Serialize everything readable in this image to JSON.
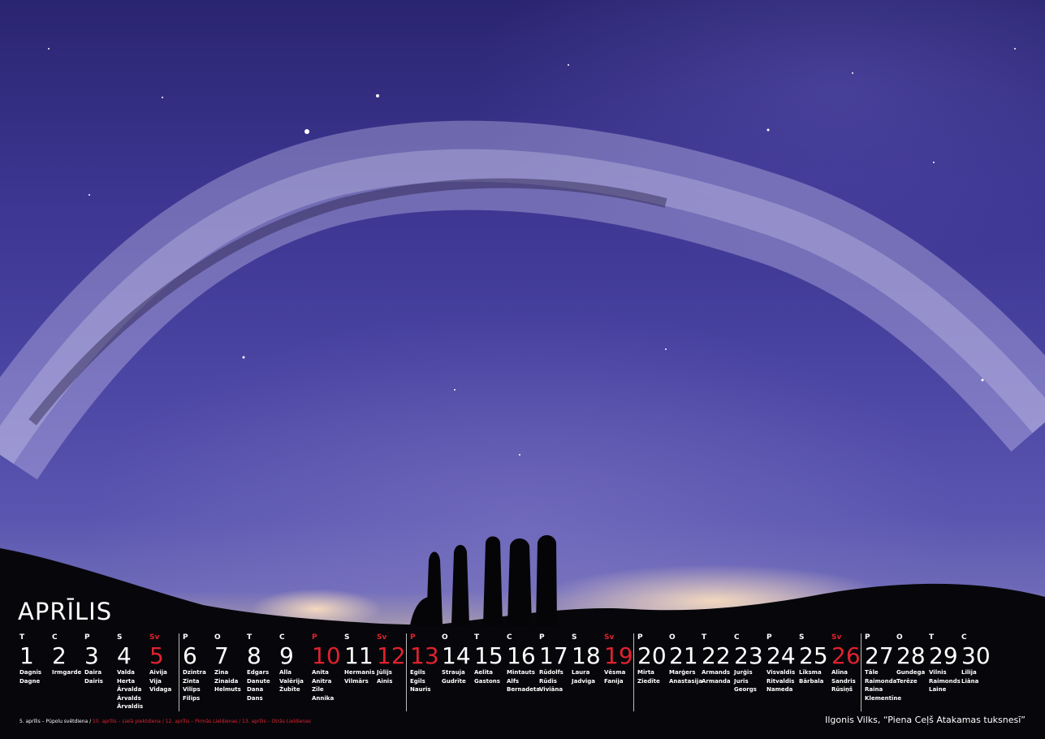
{
  "month": "APRĪLIS",
  "days": [
    {
      "dow": "T",
      "num": "1",
      "names": [
        "Dagnis",
        "Dagne"
      ],
      "red": false
    },
    {
      "dow": "C",
      "num": "2",
      "names": [
        "Irmgarde"
      ],
      "red": false
    },
    {
      "dow": "P",
      "num": "3",
      "names": [
        "Daira",
        "Dairis"
      ],
      "red": false
    },
    {
      "dow": "S",
      "num": "4",
      "names": [
        "Valda",
        "Herta",
        "Ārvalda",
        "Ārvalds",
        "Ārvaldis"
      ],
      "red": false
    },
    {
      "dow": "Sv",
      "num": "5",
      "names": [
        "Aivija",
        "Vija",
        "Vidaga"
      ],
      "red": true
    },
    {
      "dow": "P",
      "num": "6",
      "names": [
        "Dzintra",
        "Zinta",
        "Vilips",
        "Filips"
      ],
      "red": false
    },
    {
      "dow": "O",
      "num": "7",
      "names": [
        "Zina",
        "Zinaida",
        "Helmuts"
      ],
      "red": false
    },
    {
      "dow": "T",
      "num": "8",
      "names": [
        "Edgars",
        "Danute",
        "Dana",
        "Dans"
      ],
      "red": false
    },
    {
      "dow": "C",
      "num": "9",
      "names": [
        "Alla",
        "Valērija",
        "Žubīte"
      ],
      "red": false
    },
    {
      "dow": "P",
      "num": "10",
      "names": [
        "Anita",
        "Anitra",
        "Zīle",
        "Annika"
      ],
      "red": true
    },
    {
      "dow": "S",
      "num": "11",
      "names": [
        "Hermanis",
        "Vilmārs"
      ],
      "red": false
    },
    {
      "dow": "Sv",
      "num": "12",
      "names": [
        "Jūlijs",
        "Ainis"
      ],
      "red": true
    },
    {
      "dow": "P",
      "num": "13",
      "names": [
        "Egils",
        "Egīls",
        "Nauris"
      ],
      "red": true
    },
    {
      "dow": "O",
      "num": "14",
      "names": [
        "Strauja",
        "Gudrīte"
      ],
      "red": false
    },
    {
      "dow": "T",
      "num": "15",
      "names": [
        "Aelita",
        "Gastons"
      ],
      "red": false
    },
    {
      "dow": "C",
      "num": "16",
      "names": [
        "Mintauts",
        "Alfs",
        "Bernadeta"
      ],
      "red": false
    },
    {
      "dow": "P",
      "num": "17",
      "names": [
        "Rūdolfs",
        "Rūdis",
        "Viviāna"
      ],
      "red": false
    },
    {
      "dow": "S",
      "num": "18",
      "names": [
        "Laura",
        "Jadviga"
      ],
      "red": false
    },
    {
      "dow": "Sv",
      "num": "19",
      "names": [
        "Vēsma",
        "Fanija"
      ],
      "red": true
    },
    {
      "dow": "P",
      "num": "20",
      "names": [
        "Mirta",
        "Ziedīte"
      ],
      "red": false
    },
    {
      "dow": "O",
      "num": "21",
      "names": [
        "Marģers",
        "Anastasija"
      ],
      "red": false
    },
    {
      "dow": "T",
      "num": "22",
      "names": [
        "Armands",
        "Armanda"
      ],
      "red": false
    },
    {
      "dow": "C",
      "num": "23",
      "names": [
        "Jurģis",
        "Juris",
        "Georgs"
      ],
      "red": false
    },
    {
      "dow": "P",
      "num": "24",
      "names": [
        "Visvaldis",
        "Ritvaldis",
        "Nameda"
      ],
      "red": false
    },
    {
      "dow": "S",
      "num": "25",
      "names": [
        "Līksma",
        "Bārbala"
      ],
      "red": false
    },
    {
      "dow": "Sv",
      "num": "26",
      "names": [
        "Alīna",
        "Sandris",
        "Rūsiņš"
      ],
      "red": true
    },
    {
      "dow": "P",
      "num": "27",
      "names": [
        "Tāle",
        "Raimonda",
        "Raina",
        "Klementīne"
      ],
      "red": false
    },
    {
      "dow": "O",
      "num": "28",
      "names": [
        "Gundega",
        "Terēze"
      ],
      "red": false
    },
    {
      "dow": "T",
      "num": "29",
      "names": [
        "Vilnis",
        "Raimonds",
        "Laine"
      ],
      "red": false
    },
    {
      "dow": "C",
      "num": "30",
      "names": [
        "Lilija",
        "Liāna"
      ],
      "red": false
    }
  ],
  "holidays": {
    "white": "5. aprīlis – Pūpolu svētdiena / ",
    "red": "10. aprīlis – Lielā piektdiena / 12. aprīlis – Pirmās Lieldienas  / 13. aprīlis – Otrās Lieldienas"
  },
  "caption": "Ilgonis Vilks, “Piena Ceļš Atakamas tuksnesī”"
}
